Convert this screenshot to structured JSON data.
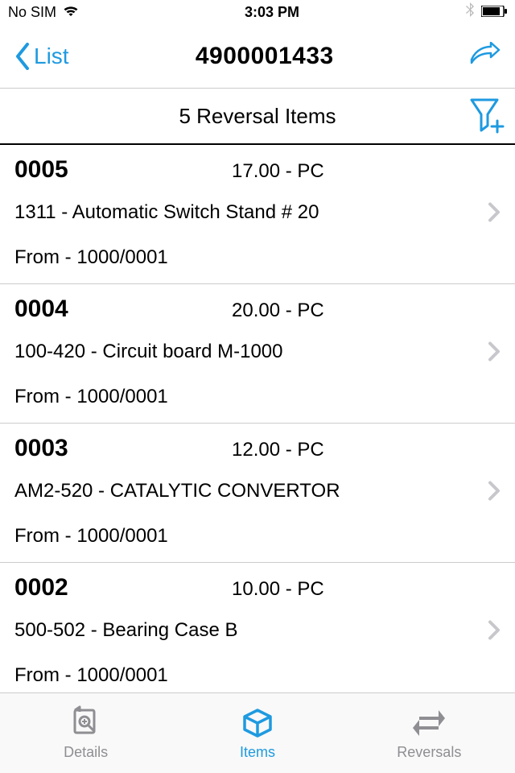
{
  "status": {
    "carrier": "No SIM",
    "time": "3:03 PM"
  },
  "nav": {
    "back_label": "List",
    "title": "4900001433"
  },
  "section": {
    "title": "5 Reversal Items"
  },
  "items": [
    {
      "id": "0005",
      "qty": "17.00 - PC",
      "desc": "1311 - Automatic Switch Stand # 20",
      "from": "From - 1000/0001"
    },
    {
      "id": "0004",
      "qty": "20.00 - PC",
      "desc": "100-420 - Circuit board M-1000",
      "from": "From - 1000/0001"
    },
    {
      "id": "0003",
      "qty": "12.00 - PC",
      "desc": "AM2-520 - CATALYTIC CONVERTOR",
      "from": "From - 1000/0001"
    },
    {
      "id": "0002",
      "qty": "10.00 - PC",
      "desc": "500-502 - Bearing    Case B",
      "from": "From - 1000/0001"
    }
  ],
  "tabs": {
    "details": "Details",
    "items": "Items",
    "reversals": "Reversals"
  },
  "colors": {
    "accent": "#1E9AE0",
    "inactive": "#8e8e93"
  }
}
